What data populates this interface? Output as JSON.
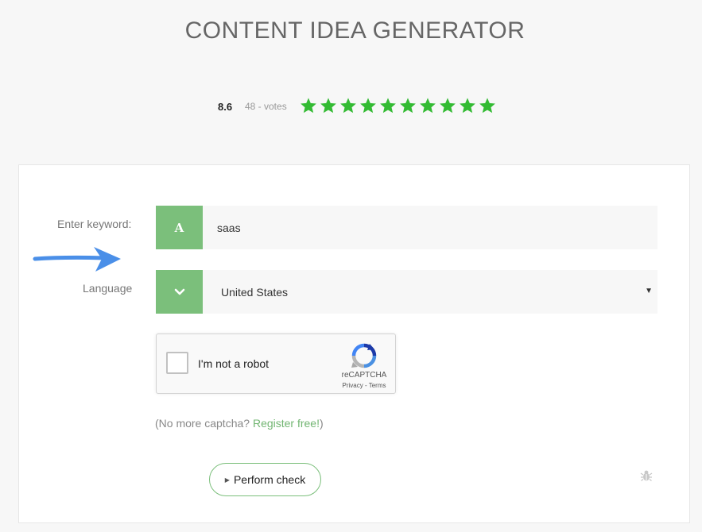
{
  "header": {
    "title": "CONTENT IDEA GENERATOR"
  },
  "rating": {
    "score": "8.6",
    "votes": "48 - votes",
    "stars_filled": 10,
    "stars_total": 10,
    "star_color": "#33bb33"
  },
  "form": {
    "keyword_label": "Enter keyword:",
    "keyword_icon_letter": "A",
    "keyword_value": "saas",
    "language_label": "Language",
    "language_value": "United States",
    "accent_color": "#7bbf7b"
  },
  "recaptcha": {
    "label": "I'm not a robot",
    "brand": "reCAPTCHA",
    "links": "Privacy - Terms",
    "checked": false
  },
  "captcha_note": {
    "prefix": "(No more captcha? ",
    "link": "Register free!",
    "suffix": ")"
  },
  "actions": {
    "perform_label": "Perform check"
  },
  "icons": {
    "keyword": "letter-a-icon",
    "language": "chevron-down-icon",
    "annotation": "blue-arrow-icon",
    "report": "bug-icon"
  }
}
